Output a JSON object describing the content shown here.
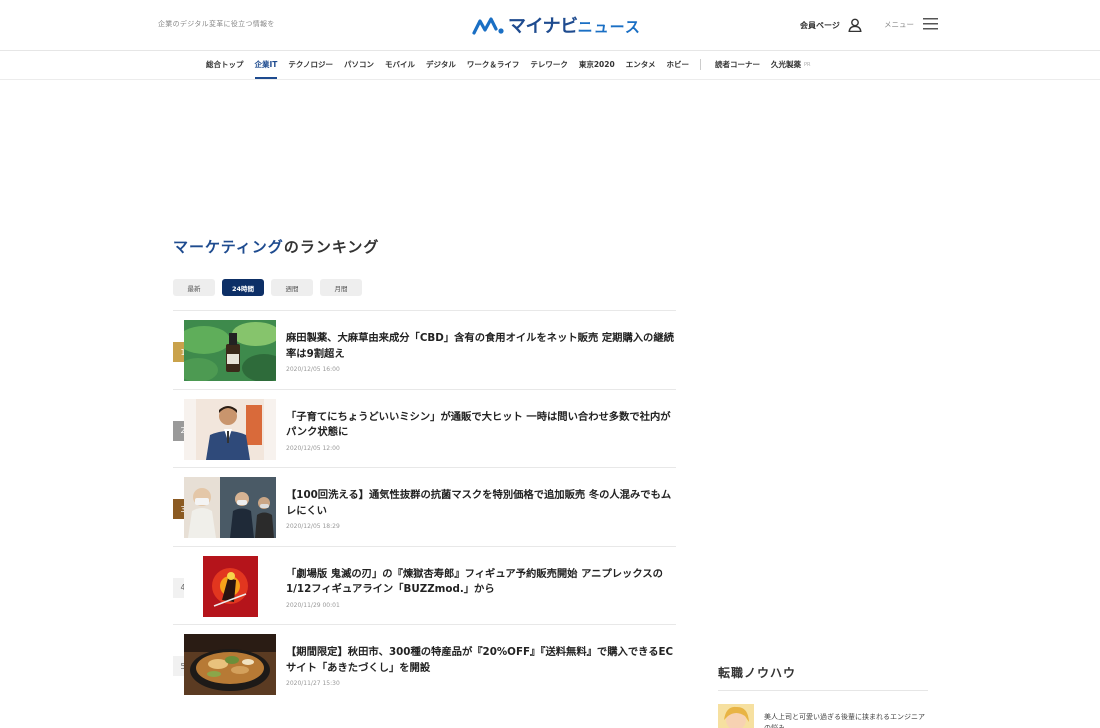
{
  "header": {
    "tagline": "企業のデジタル変革に役立つ情報を",
    "logo_text": "マイナビ",
    "logo_news": "ニュース",
    "member_label": "会員ページ",
    "menu_label": "メニュー"
  },
  "nav": {
    "items": [
      "総合トップ",
      "企業IT",
      "テクノロジー",
      "パソコン",
      "モバイル",
      "デジタル",
      "ワーク＆ライフ",
      "テレワーク",
      "東京2020",
      "エンタメ",
      "ホビー"
    ],
    "extra_items": [
      "読者コーナー",
      "久光製薬"
    ],
    "pr_label": "PR"
  },
  "ranking": {
    "title_accent": "マーケティング",
    "title_rest": "のランキング",
    "tabs": [
      "最新",
      "24時間",
      "週間",
      "月間"
    ],
    "active_tab": "24時間",
    "items": [
      {
        "rank": "1",
        "title": "麻田製薬、大麻草由来成分「CBD」含有の食用オイルをネット販売 定期購入の継続率は9割超え",
        "date": "2020/12/05 16:00"
      },
      {
        "rank": "2",
        "title": "「子育てにちょうどいいミシン」が通販で大ヒット 一時は問い合わせ多数で社内がパンク状態に",
        "date": "2020/12/05 12:00"
      },
      {
        "rank": "3",
        "title": "【100回洗える】通気性抜群の抗菌マスクを特別価格で追加販売 冬の人混みでもムレにくい",
        "date": "2020/12/05 18:29"
      },
      {
        "rank": "4",
        "title": "「劇場版 鬼滅の刃」の『煉獄杏寿郎』フィギュア予約販売開始 アニプレックスの1/12フィギュアライン「BUZZmod.」から",
        "date": "2020/11/29 00:01"
      },
      {
        "rank": "5",
        "title": "【期間限定】秋田市、300種の特産品が『20%OFF』『送料無料』で購入できるECサイト「あきたづくし」を開設",
        "date": "2020/11/27 15:30"
      }
    ]
  },
  "sidebar": {
    "title": "転職ノウハウ",
    "article_text": "美人上司と可愛い過ぎる後輩に挟まれるエンジニアの悩み"
  },
  "colors": {
    "brand": "#1e4b8f",
    "tab_active": "#0d2f66",
    "rank_gold": "#c9a24b",
    "rank_silver": "#9a9a9a",
    "rank_bronze": "#8b5a22"
  }
}
